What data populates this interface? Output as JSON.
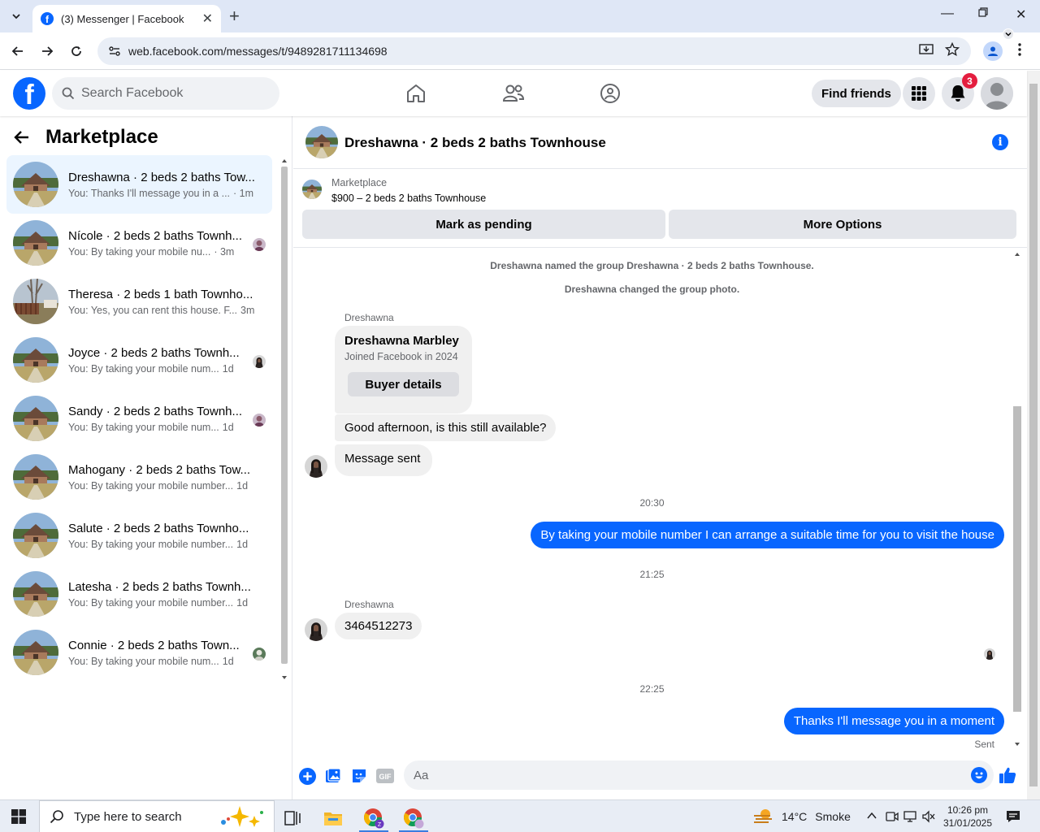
{
  "browser": {
    "tab_title": "(3) Messenger | Facebook",
    "url": "web.facebook.com/messages/t/9489281711134698"
  },
  "header": {
    "search_placeholder": "Search Facebook",
    "find_friends": "Find friends",
    "notification_count": "3"
  },
  "sidebar": {
    "title": "Marketplace",
    "conversations": [
      {
        "name": "Dreshawna · 2 beds 2 baths Tow...",
        "preview": "You: Thanks I'll message you in a ...",
        "time": "· 1m",
        "active": true,
        "seen": false,
        "photo": "house"
      },
      {
        "name": "Nícole · 2 beds 2 baths Townh...",
        "preview": "You: By taking your mobile nu...",
        "time": "· 3m",
        "active": false,
        "seen": true,
        "photo": "house"
      },
      {
        "name": "Theresa · 2 beds 1 bath Townho...",
        "preview": "You: Yes, you can rent this house. F...",
        "time": "3m",
        "active": false,
        "seen": false,
        "photo": "yard"
      },
      {
        "name": "Joyce · 2 beds 2 baths Townh...",
        "preview": "You: By taking your mobile num...",
        "time": "1d",
        "active": false,
        "seen": true,
        "photo": "house"
      },
      {
        "name": "Sandy · 2 beds 2 baths Townh...",
        "preview": "You: By taking your mobile num...",
        "time": "1d",
        "active": false,
        "seen": true,
        "photo": "house"
      },
      {
        "name": "Mahogany · 2 beds 2 baths Tow...",
        "preview": "You: By taking your mobile number...",
        "time": "1d",
        "active": false,
        "seen": false,
        "photo": "house"
      },
      {
        "name": "Salute · 2 beds 2 baths Townho...",
        "preview": "You: By taking your mobile number...",
        "time": "1d",
        "active": false,
        "seen": false,
        "photo": "house"
      },
      {
        "name": "Latesha · 2 beds 2 baths Townh...",
        "preview": "You: By taking your mobile number...",
        "time": "1d",
        "active": false,
        "seen": false,
        "photo": "house"
      },
      {
        "name": "Connie · 2 beds 2 baths Town...",
        "preview": "You: By taking your mobile num...",
        "time": "1d",
        "active": false,
        "seen": true,
        "photo": "house"
      }
    ]
  },
  "chat": {
    "title": "Dreshawna · 2 beds 2 baths Townhouse",
    "listing": {
      "source": "Marketplace",
      "price": "$900 – 2 beds 2 baths Townhouse",
      "pending_button": "Mark as pending",
      "options_button": "More Options"
    },
    "system_1": "Dreshawna named the group Dreshawna · 2 beds 2 baths Townhouse.",
    "system_2": "Dreshawna changed the group photo.",
    "sender_name": "Dreshawna",
    "buyer_card": {
      "name": "Dreshawna Marbley",
      "joined": "Joined Facebook in 2024",
      "button": "Buyer details"
    },
    "msg_in_1": "Good afternoon, is this still available?",
    "msg_in_2": "Message sent",
    "time_1": "20:30",
    "msg_out_1": "By taking your mobile number I can arrange a suitable time for you to visit the house",
    "time_2": "21:25",
    "msg_in_3": "3464512273",
    "time_3": "22:25",
    "msg_out_2": "Thanks I'll message you in a moment",
    "status": "Sent",
    "composer_placeholder": "Aa"
  },
  "taskbar": {
    "search_placeholder": "Type here to search",
    "temperature": "14°C",
    "weather": "Smoke",
    "time": "10:26 pm",
    "date": "31/01/2025"
  },
  "colors": {
    "brand": "#0866ff",
    "active_row": "#ebf5ff",
    "badge": "#e41e3f"
  }
}
